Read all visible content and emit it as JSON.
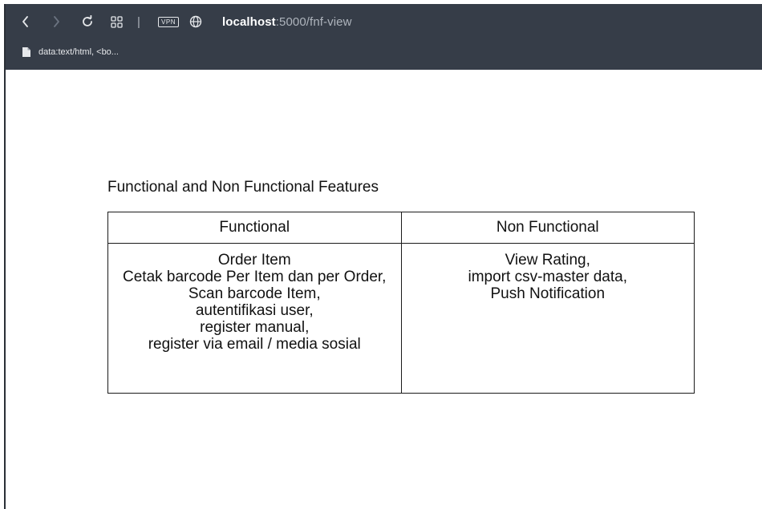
{
  "browser": {
    "url_host": "localhost",
    "url_path": ":5000/fnf-view",
    "vpn_label": "VPN",
    "separator": "|",
    "tab_title": "data:text/html, <bo...",
    "colors": {
      "toolbar_bg": "#363d48",
      "text": "#e6e8eb",
      "url_path": "#aeb4bc"
    }
  },
  "page": {
    "heading": "Functional and Non Functional Features",
    "table": {
      "headers": [
        "Functional",
        "Non Functional"
      ],
      "functional_items": [
        "Order Item",
        "Cetak barcode Per Item dan per Order,",
        "Scan barcode Item,",
        "autentifikasi user,",
        "register manual,",
        "register via email / media sosial"
      ],
      "non_functional_items": [
        "View Rating,",
        "import csv-master data,",
        "Push Notification"
      ]
    }
  }
}
